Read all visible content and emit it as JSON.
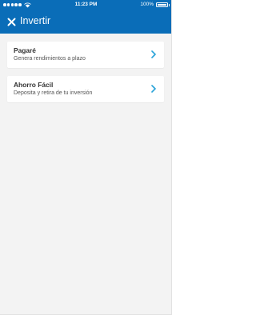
{
  "status_bar": {
    "time": "11:23 PM",
    "battery_percent": "100%",
    "battery_level": 1.0,
    "signal_icon": "signal-dots-icon",
    "wifi_icon": "wifi-icon",
    "battery_icon": "battery-icon"
  },
  "header": {
    "title": "Invertir",
    "close_icon": "close-icon",
    "background_color": "#0a6db8"
  },
  "options": [
    {
      "title": "Pagaré",
      "subtitle": "Genera rendimientos a plazo",
      "icon": "chevron-right-icon"
    },
    {
      "title": "Ahorro Fácil",
      "subtitle": "Deposita y retira de tu inversión",
      "icon": "chevron-right-icon"
    }
  ],
  "colors": {
    "accent": "#0a6db8",
    "chevron": "#2aa3d8",
    "background": "#f3f3f3"
  }
}
